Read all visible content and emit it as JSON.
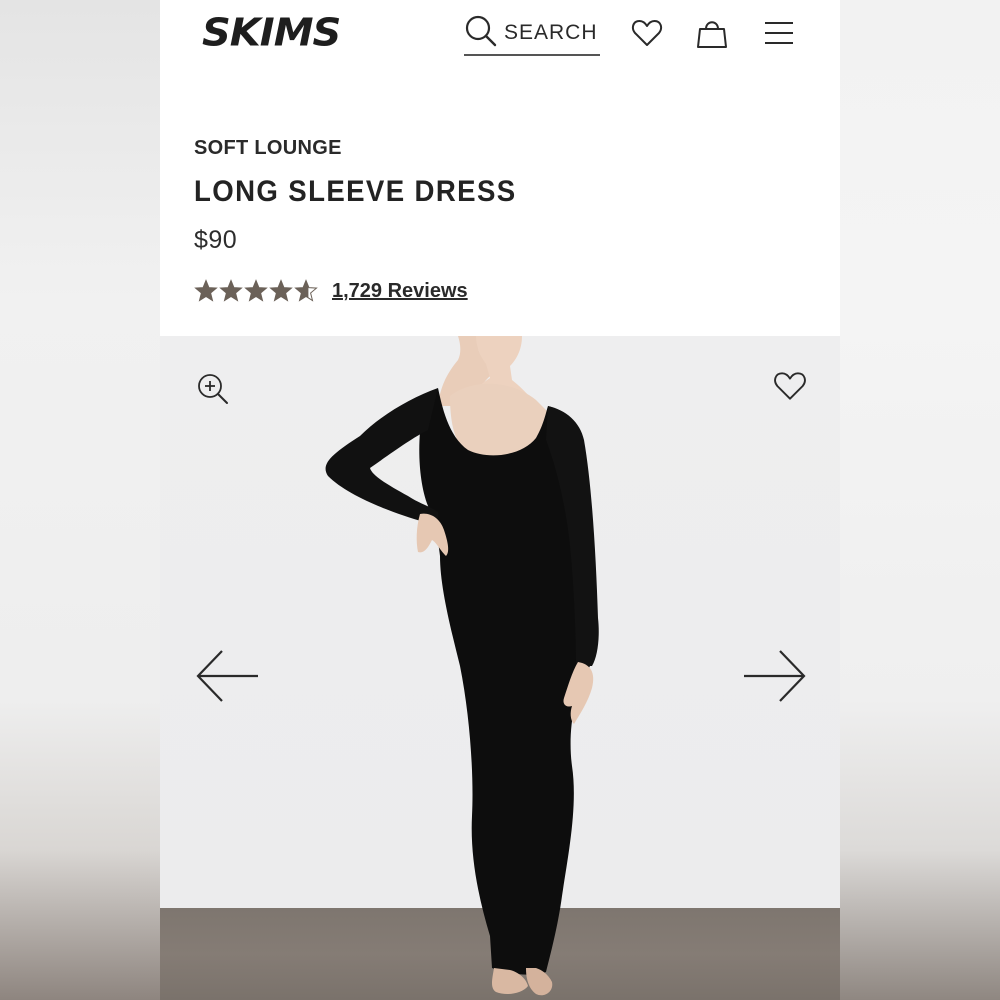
{
  "header": {
    "logo": "SKIMS",
    "search_label": "SEARCH"
  },
  "product": {
    "collection": "SOFT LOUNGE",
    "title": "LONG SLEEVE DRESS",
    "price": "$90",
    "rating": 4.6,
    "reviews_label": "1,729 Reviews"
  },
  "colors": {
    "star": "#6b6158",
    "text": "#2a2a2a",
    "dress": "#0d0d0d",
    "gallery_bg": "#ececed",
    "floor": "#837a73"
  },
  "icons": {
    "search": "search-icon",
    "wishlist": "heart-icon",
    "bag": "shopping-bag-icon",
    "menu": "hamburger-menu-icon",
    "zoom": "zoom-in-icon",
    "image_favorite": "heart-icon",
    "prev": "arrow-left-icon",
    "next": "arrow-right-icon"
  }
}
